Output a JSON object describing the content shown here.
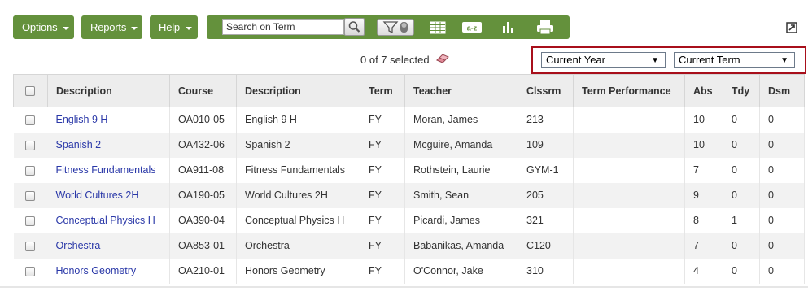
{
  "toolbar": {
    "options_label": "Options",
    "reports_label": "Reports",
    "help_label": "Help",
    "search_placeholder": "Search on Term",
    "icons": [
      "search-icon",
      "filter-icon",
      "grid-icon",
      "sort-az-icon",
      "chart-icon",
      "print-icon",
      "expand-icon",
      "eraser-icon"
    ]
  },
  "selection": {
    "text": "0 of 7 selected"
  },
  "filters": {
    "year_selected": "Current Year",
    "term_selected": "Current Term",
    "highlight_color": "#a80f1b"
  },
  "colors": {
    "toolbar_green": "#64913c",
    "link_blue": "#2a38a8"
  },
  "table": {
    "headers": [
      "Description",
      "Course",
      "Description",
      "Term",
      "Teacher",
      "Clssrm",
      "Term Performance",
      "Abs",
      "Tdy",
      "Dsm"
    ],
    "rows": [
      {
        "course_desc": "English 9 H",
        "course": "OA010-05",
        "description": "English 9 H",
        "term": "FY",
        "teacher": "Moran, James",
        "room": "213",
        "perf": "",
        "abs": "10",
        "tdy": "0",
        "dsm": "0"
      },
      {
        "course_desc": "Spanish 2",
        "course": "OA432-06",
        "description": "Spanish 2",
        "term": "FY",
        "teacher": "Mcguire, Amanda",
        "room": "109",
        "perf": "",
        "abs": "10",
        "tdy": "0",
        "dsm": "0"
      },
      {
        "course_desc": "Fitness Fundamentals",
        "course": "OA911-08",
        "description": "Fitness Fundamentals",
        "term": "FY",
        "teacher": "Rothstein, Laurie",
        "room": "GYM-1",
        "perf": "",
        "abs": "7",
        "tdy": "0",
        "dsm": "0"
      },
      {
        "course_desc": "World Cultures 2H",
        "course": "OA190-05",
        "description": "World Cultures 2H",
        "term": "FY",
        "teacher": "Smith, Sean",
        "room": "205",
        "perf": "",
        "abs": "9",
        "tdy": "0",
        "dsm": "0"
      },
      {
        "course_desc": "Conceptual Physics H",
        "course": "OA390-04",
        "description": "Conceptual Physics H",
        "term": "FY",
        "teacher": "Picardi, James",
        "room": "321",
        "perf": "",
        "abs": "8",
        "tdy": "1",
        "dsm": "0"
      },
      {
        "course_desc": "Orchestra",
        "course": "OA853-01",
        "description": "Orchestra",
        "term": "FY",
        "teacher": "Babanikas, Amanda",
        "room": "C120",
        "perf": "",
        "abs": "7",
        "tdy": "0",
        "dsm": "0"
      },
      {
        "course_desc": "Honors Geometry",
        "course": "OA210-01",
        "description": "Honors Geometry",
        "term": "FY",
        "teacher": "O'Connor, Jake",
        "room": "310",
        "perf": "",
        "abs": "4",
        "tdy": "0",
        "dsm": "0"
      }
    ]
  }
}
